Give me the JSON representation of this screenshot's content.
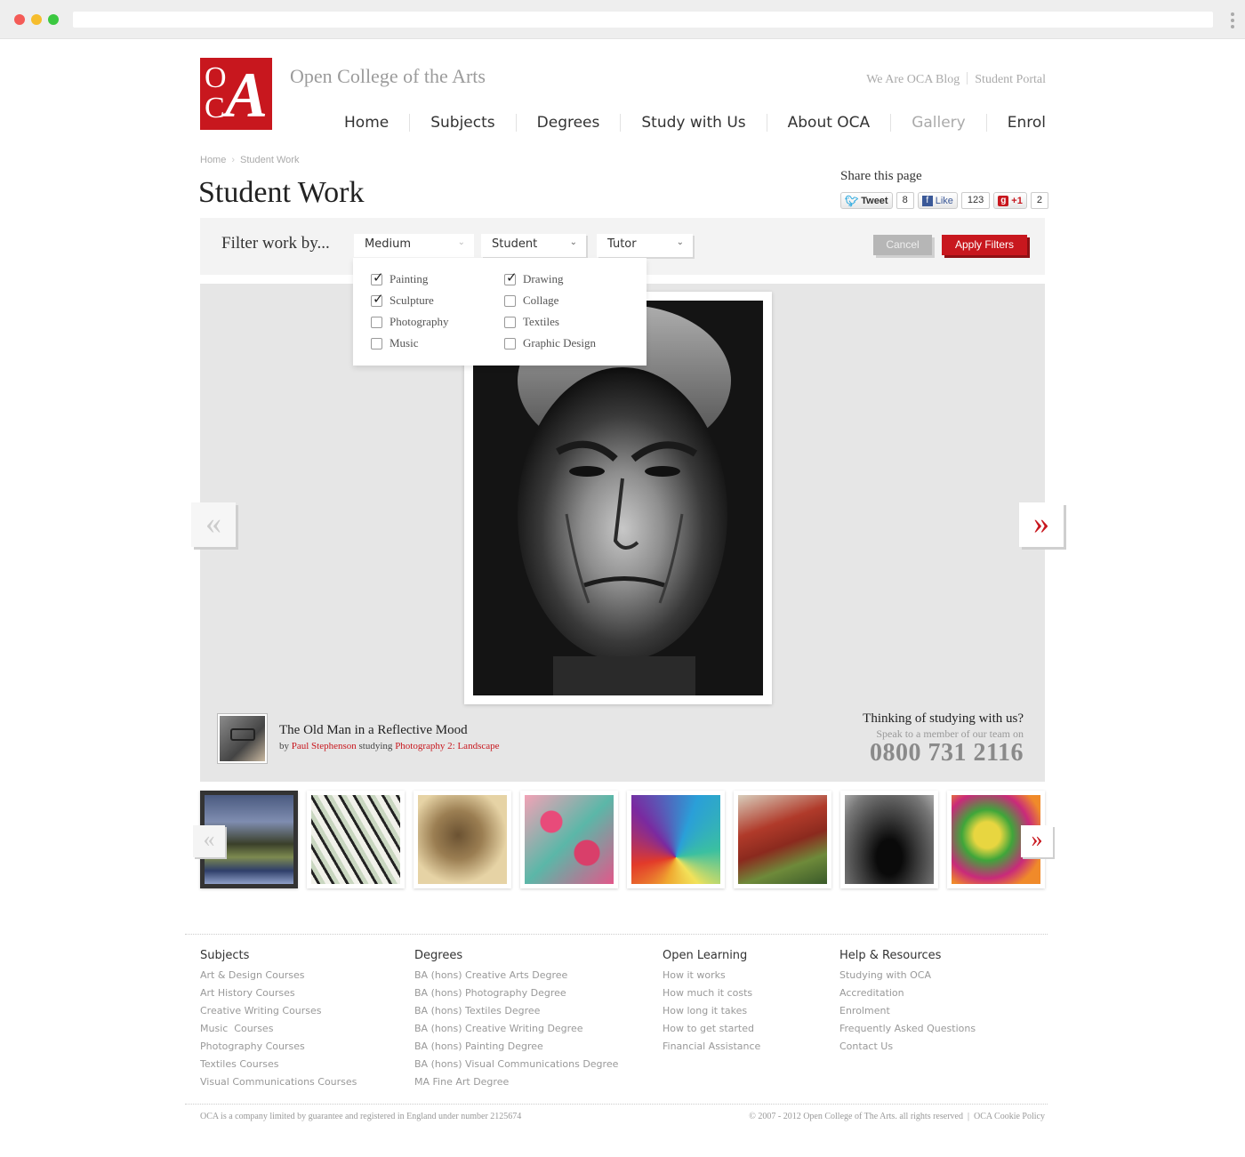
{
  "header": {
    "logo_line1": "O",
    "logo_line2": "C",
    "logo_big": "A",
    "site_title": "Open College of the Arts",
    "top_links": [
      "We Are OCA Blog",
      "Student Portal"
    ],
    "nav": [
      "Home",
      "Subjects",
      "Degrees",
      "Study with Us",
      "About OCA",
      "Gallery",
      "Enrol"
    ],
    "nav_active": "Gallery"
  },
  "breadcrumb": [
    "Home",
    "Student Work"
  ],
  "page_title": "Student Work",
  "share": {
    "label": "Share this page",
    "tweet_label": "Tweet",
    "tweet_count": "8",
    "like_label": "Like",
    "like_count": "123",
    "plus_label": "+1",
    "plus_count": "2"
  },
  "filter": {
    "label": "Filter work by...",
    "selects": [
      "Medium",
      "Student",
      "Tutor"
    ],
    "cancel_label": "Cancel",
    "apply_label": "Apply Filters",
    "medium_options": [
      {
        "label": "Painting",
        "checked": true
      },
      {
        "label": "Sculpture",
        "checked": true
      },
      {
        "label": "Photography",
        "checked": false
      },
      {
        "label": "Music",
        "checked": false
      },
      {
        "label": "Drawing",
        "checked": true
      },
      {
        "label": "Collage",
        "checked": false
      },
      {
        "label": "Textiles",
        "checked": false
      },
      {
        "label": "Graphic Design",
        "checked": false
      }
    ]
  },
  "gallery": {
    "prev_glyph": "«",
    "next_glyph": "»",
    "work_title": "The Old Man in a Reflective Mood",
    "by_prefix": "by",
    "artist_name": "Paul Stephenson",
    "studying_word": "studying",
    "course": "Photography 2: Landscape",
    "promo_question": "Thinking of studying with us?",
    "promo_sub": "Speak to a member of our team on",
    "promo_phone": "0800 731 2116",
    "thumb_count": 8
  },
  "footer": {
    "columns": [
      {
        "heading": "Subjects",
        "links": [
          "Art & Design Courses",
          "Art History Courses",
          "Creative Writing Courses",
          "Music  Courses",
          "Photography Courses",
          "Textiles Courses",
          "Visual Communications Courses"
        ]
      },
      {
        "heading": "Degrees",
        "links": [
          "BA (hons) Creative Arts Degree",
          "BA (hons) Photography Degree",
          "BA (hons) Textiles Degree",
          "BA (hons) Creative Writing Degree",
          "BA (hons) Painting Degree",
          "BA (hons) Visual Communications Degree",
          "MA Fine Art Degree"
        ]
      },
      {
        "heading": "Open Learning",
        "links": [
          "How it works",
          "How much it costs",
          "How long it takes",
          "How to get started",
          "Financial Assistance"
        ]
      },
      {
        "heading": "Help & Resources",
        "links": [
          "Studying with OCA",
          "Accreditation",
          "Enrolment",
          "Frequently Asked Questions",
          "Contact Us"
        ]
      }
    ],
    "legal_left": "OCA is a company limited by guarantee and registered in England under number 2125674",
    "legal_right": "© 2007 - 2012 Open College of The Arts. all rights reserved",
    "cookie_link": "OCA Cookie Policy"
  },
  "colors": {
    "brand_red": "#c8171e",
    "stage_grey": "#e6e6e6",
    "filter_bar": "#f3f3f3"
  }
}
